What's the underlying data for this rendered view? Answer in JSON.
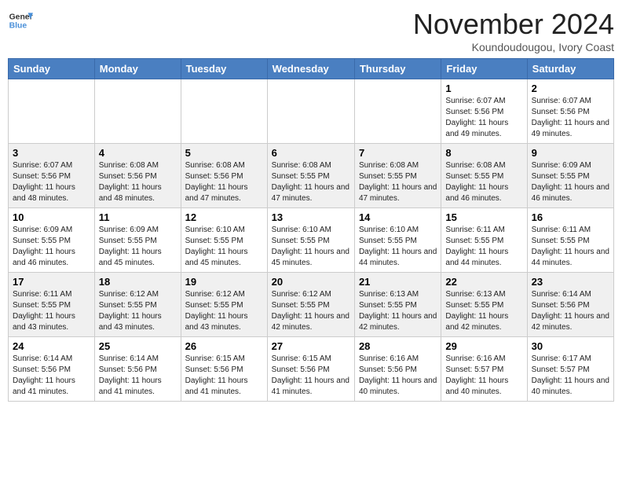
{
  "header": {
    "logo_general": "General",
    "logo_blue": "Blue",
    "month_title": "November 2024",
    "location": "Koundoudougou, Ivory Coast"
  },
  "days_of_week": [
    "Sunday",
    "Monday",
    "Tuesday",
    "Wednesday",
    "Thursday",
    "Friday",
    "Saturday"
  ],
  "weeks": [
    [
      null,
      null,
      null,
      null,
      null,
      {
        "day": 1,
        "sunrise": "6:07 AM",
        "sunset": "5:56 PM",
        "daylight": "11 hours and 49 minutes."
      },
      {
        "day": 2,
        "sunrise": "6:07 AM",
        "sunset": "5:56 PM",
        "daylight": "11 hours and 49 minutes."
      }
    ],
    [
      {
        "day": 3,
        "sunrise": "6:07 AM",
        "sunset": "5:56 PM",
        "daylight": "11 hours and 48 minutes."
      },
      {
        "day": 4,
        "sunrise": "6:08 AM",
        "sunset": "5:56 PM",
        "daylight": "11 hours and 48 minutes."
      },
      {
        "day": 5,
        "sunrise": "6:08 AM",
        "sunset": "5:56 PM",
        "daylight": "11 hours and 47 minutes."
      },
      {
        "day": 6,
        "sunrise": "6:08 AM",
        "sunset": "5:55 PM",
        "daylight": "11 hours and 47 minutes."
      },
      {
        "day": 7,
        "sunrise": "6:08 AM",
        "sunset": "5:55 PM",
        "daylight": "11 hours and 47 minutes."
      },
      {
        "day": 8,
        "sunrise": "6:08 AM",
        "sunset": "5:55 PM",
        "daylight": "11 hours and 46 minutes."
      },
      {
        "day": 9,
        "sunrise": "6:09 AM",
        "sunset": "5:55 PM",
        "daylight": "11 hours and 46 minutes."
      }
    ],
    [
      {
        "day": 10,
        "sunrise": "6:09 AM",
        "sunset": "5:55 PM",
        "daylight": "11 hours and 46 minutes."
      },
      {
        "day": 11,
        "sunrise": "6:09 AM",
        "sunset": "5:55 PM",
        "daylight": "11 hours and 45 minutes."
      },
      {
        "day": 12,
        "sunrise": "6:10 AM",
        "sunset": "5:55 PM",
        "daylight": "11 hours and 45 minutes."
      },
      {
        "day": 13,
        "sunrise": "6:10 AM",
        "sunset": "5:55 PM",
        "daylight": "11 hours and 45 minutes."
      },
      {
        "day": 14,
        "sunrise": "6:10 AM",
        "sunset": "5:55 PM",
        "daylight": "11 hours and 44 minutes."
      },
      {
        "day": 15,
        "sunrise": "6:11 AM",
        "sunset": "5:55 PM",
        "daylight": "11 hours and 44 minutes."
      },
      {
        "day": 16,
        "sunrise": "6:11 AM",
        "sunset": "5:55 PM",
        "daylight": "11 hours and 44 minutes."
      }
    ],
    [
      {
        "day": 17,
        "sunrise": "6:11 AM",
        "sunset": "5:55 PM",
        "daylight": "11 hours and 43 minutes."
      },
      {
        "day": 18,
        "sunrise": "6:12 AM",
        "sunset": "5:55 PM",
        "daylight": "11 hours and 43 minutes."
      },
      {
        "day": 19,
        "sunrise": "6:12 AM",
        "sunset": "5:55 PM",
        "daylight": "11 hours and 43 minutes."
      },
      {
        "day": 20,
        "sunrise": "6:12 AM",
        "sunset": "5:55 PM",
        "daylight": "11 hours and 42 minutes."
      },
      {
        "day": 21,
        "sunrise": "6:13 AM",
        "sunset": "5:55 PM",
        "daylight": "11 hours and 42 minutes."
      },
      {
        "day": 22,
        "sunrise": "6:13 AM",
        "sunset": "5:55 PM",
        "daylight": "11 hours and 42 minutes."
      },
      {
        "day": 23,
        "sunrise": "6:14 AM",
        "sunset": "5:56 PM",
        "daylight": "11 hours and 42 minutes."
      }
    ],
    [
      {
        "day": 24,
        "sunrise": "6:14 AM",
        "sunset": "5:56 PM",
        "daylight": "11 hours and 41 minutes."
      },
      {
        "day": 25,
        "sunrise": "6:14 AM",
        "sunset": "5:56 PM",
        "daylight": "11 hours and 41 minutes."
      },
      {
        "day": 26,
        "sunrise": "6:15 AM",
        "sunset": "5:56 PM",
        "daylight": "11 hours and 41 minutes."
      },
      {
        "day": 27,
        "sunrise": "6:15 AM",
        "sunset": "5:56 PM",
        "daylight": "11 hours and 41 minutes."
      },
      {
        "day": 28,
        "sunrise": "6:16 AM",
        "sunset": "5:56 PM",
        "daylight": "11 hours and 40 minutes."
      },
      {
        "day": 29,
        "sunrise": "6:16 AM",
        "sunset": "5:57 PM",
        "daylight": "11 hours and 40 minutes."
      },
      {
        "day": 30,
        "sunrise": "6:17 AM",
        "sunset": "5:57 PM",
        "daylight": "11 hours and 40 minutes."
      }
    ]
  ],
  "labels": {
    "sunrise": "Sunrise:",
    "sunset": "Sunset:",
    "daylight": "Daylight hours"
  }
}
